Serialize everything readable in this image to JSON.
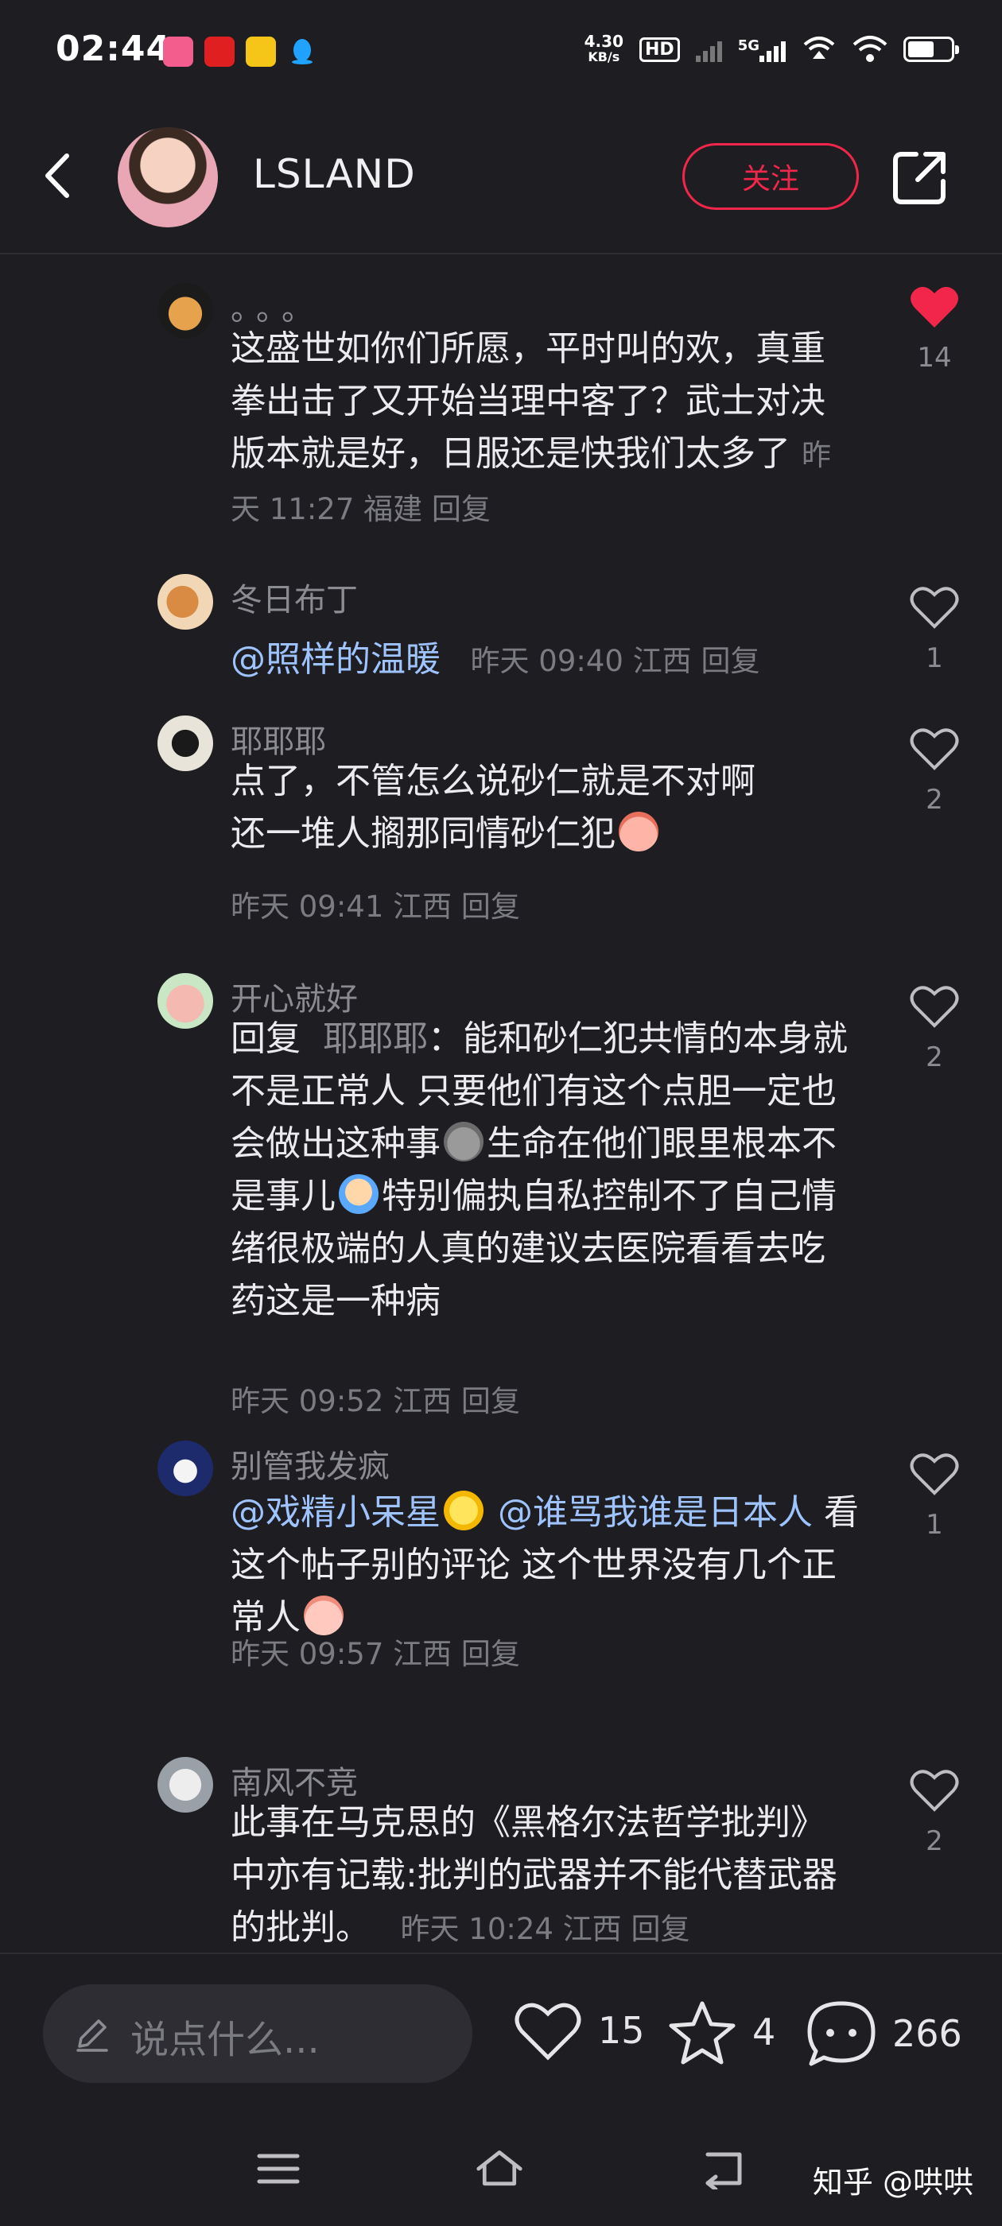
{
  "status_bar": {
    "time": "02:44",
    "net_speed_value": "4.30",
    "net_speed_unit": "KB/s",
    "hd_label": "HD",
    "network_label": "5G"
  },
  "header": {
    "username": "LSLAND",
    "follow_label": "关注"
  },
  "comments": [
    {
      "name": "。。。",
      "text": "这盛世如你们所愿，平时叫的欢，真重拳出击了又开始当理中客了？武士对决版本就是好，日服还是快我们太多了",
      "time": "昨天 11:27",
      "location": "福建",
      "reply_label": "回复",
      "likes": "14",
      "liked": true
    },
    {
      "name": "冬日布丁",
      "mention": "@照样的温暖",
      "time": "昨天 09:40",
      "location": "江西",
      "reply_label": "回复",
      "likes": "1"
    },
    {
      "name": "耶耶耶",
      "text_line1": "点了，不管怎么说砂仁就是不对啊",
      "text_line2": "还一堆人搁那同情砂仁犯",
      "time": "昨天 09:41",
      "location": "江西",
      "reply_label": "回复",
      "likes": "2"
    },
    {
      "name": "开心就好",
      "reply_prefix": "回复",
      "reply_to": "耶耶耶",
      "text_part1": "：能和砂仁犯共情的本身就不是正常人 只要他们有这个点胆一定也会做出这种事",
      "text_part2": "生命在他们眼里根本不是事儿",
      "text_part3": "特别偏执自私控制不了自己情绪很极端的人真的建议去医院看看去吃药这是一种病",
      "time": "昨天 09:52",
      "location": "江西",
      "reply_label": "回复",
      "likes": "2"
    },
    {
      "name": "别管我发疯",
      "mention1": "@戏精小呆星",
      "mention2": "@谁骂我谁是日本人",
      "text": "看这个帖子别的评论 这个世界没有几个正常人",
      "time": "昨天 09:57",
      "location": "江西",
      "reply_label": "回复",
      "likes": "1"
    },
    {
      "name": "南风不竞",
      "text": "此事在马克思的《黑格尔法哲学批判》中亦有记载:批判的武器并不能代替武器的批判。",
      "time": "昨天 10:24",
      "location": "江西",
      "reply_label": "回复",
      "likes": "2"
    }
  ],
  "bottom_bar": {
    "input_placeholder": "说点什么...",
    "like_count": "15",
    "favorite_count": "4",
    "comment_count": "266"
  },
  "watermark": "知乎 @哄哄",
  "colors": {
    "background": "#1e1e22",
    "accent_red": "#f2264a",
    "mention_blue": "#9ec3ff"
  }
}
